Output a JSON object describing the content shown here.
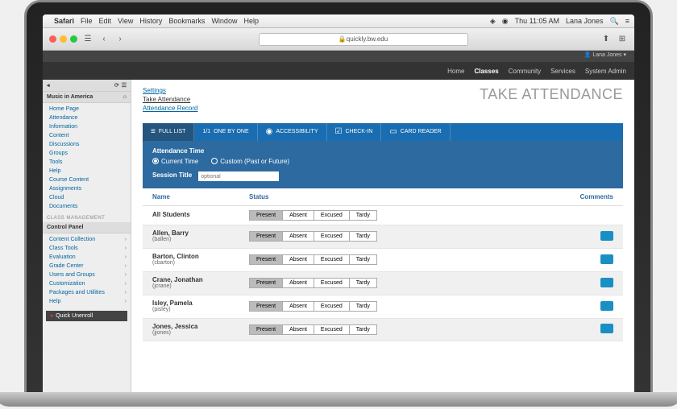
{
  "menubar": {
    "app": "Safari",
    "items": [
      "File",
      "Edit",
      "View",
      "History",
      "Bookmarks",
      "Window",
      "Help"
    ],
    "clock": "Thu 11:05 AM",
    "user": "Lana Jones"
  },
  "address": "quickly.bw.edu",
  "userbar": "Lana Jones",
  "topnav": {
    "items": [
      "Home",
      "Classes",
      "Community",
      "Services",
      "System Admin"
    ],
    "activeIndex": 1
  },
  "sidebar": {
    "course": "Music in America",
    "nav": [
      "Home Page",
      "Attendance",
      "Information",
      "Content",
      "Discussions",
      "Groups",
      "Tools",
      "Help",
      "Course Content",
      "Assignments",
      "Cloud",
      "Documents"
    ],
    "mgmtTitle": "CLASS MANAGEMENT",
    "panel": "Control Panel",
    "mgmt": [
      "Content Collection",
      "Class Tools",
      "Evaluation",
      "Grade Center",
      "Users and Groups",
      "Customization",
      "Packages and Utilities",
      "Help"
    ],
    "unenroll": "Quick Unenroll"
  },
  "crumbs": {
    "a": "Settings",
    "b": "Take Attendance",
    "c": "Attendance Record"
  },
  "pageTitle": "TAKE ATTENDANCE",
  "tabs": {
    "full": "FULL LIST",
    "count": "1/1",
    "one": "ONE BY ONE",
    "acc": "ACCESSIBILITY",
    "check": "CHECK-IN",
    "card": "CARD READER"
  },
  "panel": {
    "timeLabel": "Attendance Time",
    "opt1": "Current Time",
    "opt2": "Custom (Past or Future)",
    "sessionLabel": "Session Title",
    "placeholder": "optional"
  },
  "thead": {
    "name": "Name",
    "status": "Status",
    "comments": "Comments"
  },
  "statuses": [
    "Present",
    "Absent",
    "Excused",
    "Tardy"
  ],
  "rows": [
    {
      "name": "All Students",
      "sub": "",
      "comment": false
    },
    {
      "name": "Allen, Barry",
      "sub": "(ballen)",
      "comment": true
    },
    {
      "name": "Barton, Clinton",
      "sub": "(cbarton)",
      "comment": true
    },
    {
      "name": "Crane, Jonathan",
      "sub": "(jcrane)",
      "comment": true
    },
    {
      "name": "Isley, Pamela",
      "sub": "(pisley)",
      "comment": true
    },
    {
      "name": "Jones, Jessica",
      "sub": "(jjones)",
      "comment": true
    }
  ]
}
